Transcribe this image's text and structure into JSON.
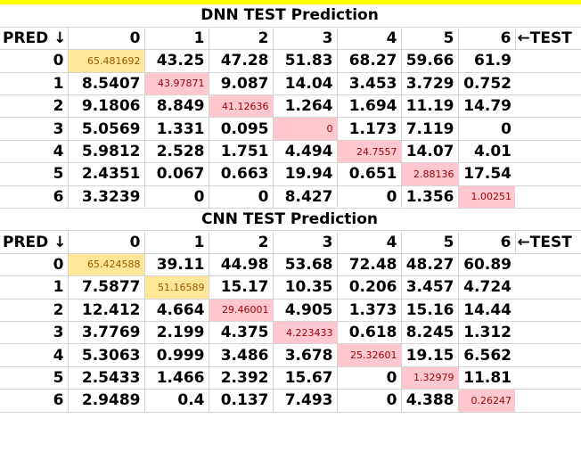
{
  "accent_yellow": "#ffe699",
  "accent_pink": "#ffc7ce",
  "dnn": {
    "title": "DNN TEST Prediction",
    "pred_label": "PRED ↓",
    "test_label": "←TEST",
    "columns": [
      "0",
      "1",
      "2",
      "3",
      "4",
      "5",
      "6"
    ],
    "rows": [
      {
        "label": "0",
        "cells": [
          "65.481692",
          "43.25",
          "47.28",
          "51.83",
          "68.27",
          "59.66",
          "61.9"
        ]
      },
      {
        "label": "1",
        "cells": [
          "8.5407",
          "43.97871",
          "9.087",
          "14.04",
          "3.453",
          "3.729",
          "0.752"
        ]
      },
      {
        "label": "2",
        "cells": [
          "9.1806",
          "8.849",
          "41.12636",
          "1.264",
          "1.694",
          "11.19",
          "14.79"
        ]
      },
      {
        "label": "3",
        "cells": [
          "5.0569",
          "1.331",
          "0.095",
          "0",
          "1.173",
          "7.119",
          "0"
        ]
      },
      {
        "label": "4",
        "cells": [
          "5.9812",
          "2.528",
          "1.751",
          "4.494",
          "24.7557",
          "14.07",
          "4.01"
        ]
      },
      {
        "label": "5",
        "cells": [
          "2.4351",
          "0.067",
          "0.663",
          "19.94",
          "0.651",
          "2.88136",
          "17.54"
        ]
      },
      {
        "label": "6",
        "cells": [
          "3.3239",
          "0",
          "0",
          "8.427",
          "0",
          "1.356",
          "1.00251"
        ]
      }
    ],
    "diag_colors": [
      "yellow",
      "pink",
      "pink",
      "pink",
      "pink",
      "pink",
      "pink"
    ]
  },
  "cnn": {
    "title": "CNN TEST Prediction",
    "pred_label": "PRED ↓",
    "test_label": "←TEST",
    "columns": [
      "0",
      "1",
      "2",
      "3",
      "4",
      "5",
      "6"
    ],
    "rows": [
      {
        "label": "0",
        "cells": [
          "65.424588",
          "39.11",
          "44.98",
          "53.68",
          "72.48",
          "48.27",
          "60.89"
        ]
      },
      {
        "label": "1",
        "cells": [
          "7.5877",
          "51.16589",
          "15.17",
          "10.35",
          "0.206",
          "3.457",
          "4.724"
        ]
      },
      {
        "label": "2",
        "cells": [
          "12.412",
          "4.664",
          "29.46001",
          "4.905",
          "1.373",
          "15.16",
          "14.44"
        ]
      },
      {
        "label": "3",
        "cells": [
          "3.7769",
          "2.199",
          "4.375",
          "4.223433",
          "0.618",
          "8.245",
          "1.312"
        ]
      },
      {
        "label": "4",
        "cells": [
          "5.3063",
          "0.999",
          "3.486",
          "3.678",
          "25.32601",
          "19.15",
          "6.562"
        ]
      },
      {
        "label": "5",
        "cells": [
          "2.5433",
          "1.466",
          "2.392",
          "15.67",
          "0",
          "1.32979",
          "11.81"
        ]
      },
      {
        "label": "6",
        "cells": [
          "2.9489",
          "0.4",
          "0.137",
          "7.493",
          "0",
          "4.388",
          "0.26247"
        ]
      }
    ],
    "diag_colors": [
      "yellow",
      "yellow",
      "pink",
      "pink",
      "pink",
      "pink",
      "pink"
    ]
  }
}
